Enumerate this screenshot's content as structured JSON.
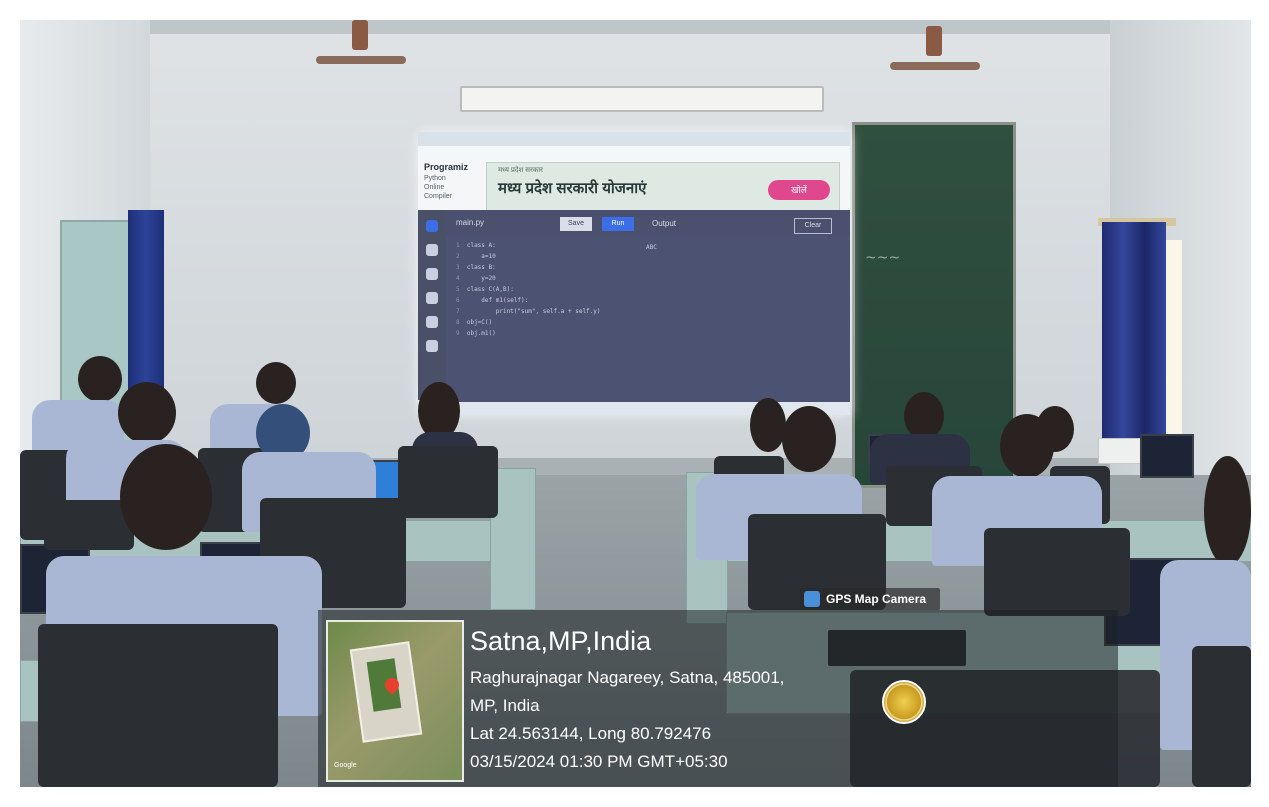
{
  "projected_screen": {
    "logo_text": "Programiz",
    "logo_sub": "Python Online Compiler",
    "ad_small_text": "मध्य प्रदेश सरकार",
    "ad_title": "मध्य प्रदेश सरकारी योजनाएं",
    "ad_button": "खोलें",
    "filename": "main.py",
    "save_label": "Save",
    "run_label": "Run",
    "output_label": "Output",
    "clear_label": "Clear",
    "output_text": "ABC",
    "code_lines": [
      {
        "num": "1",
        "text": "class A:"
      },
      {
        "num": "2",
        "text": "    a=10"
      },
      {
        "num": "3",
        "text": "class B:"
      },
      {
        "num": "4",
        "text": "    y=20"
      },
      {
        "num": "5",
        "text": "class C(A,B):"
      },
      {
        "num": "6",
        "text": "    def m1(self):"
      },
      {
        "num": "7",
        "text": "        print(\"sum\", self.a + self.y)"
      },
      {
        "num": "8",
        "text": "obj=C()"
      },
      {
        "num": "9",
        "text": "obj.m1()"
      }
    ]
  },
  "gps_overlay": {
    "badge_label": "GPS Map Camera",
    "location_title": "Satna,MP,India",
    "address_line1": "Raghurajnagar Nagareey, Satna, 485001,",
    "address_line2": "MP, India",
    "coordinates": "Lat 24.563144, Long 80.792476",
    "timestamp": "03/15/2024 01:30 PM GMT+05:30",
    "map_attribution": "Google"
  },
  "colors": {
    "run_button": "#3c6ee8",
    "ad_button": "#e0488d",
    "curtain": "#2d4399",
    "map_marker": "#e8402e"
  }
}
